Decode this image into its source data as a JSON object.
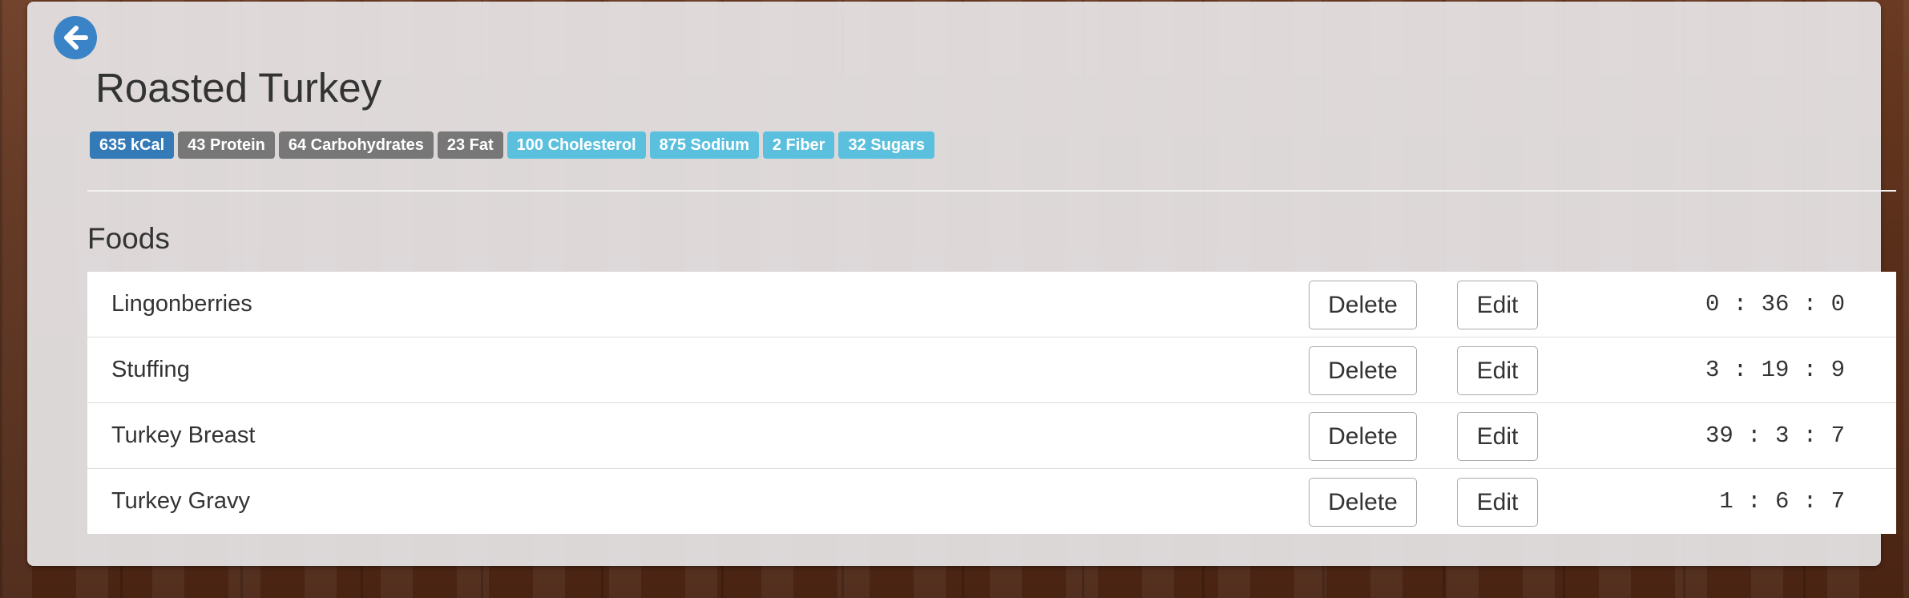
{
  "recipe": {
    "title": "Roasted Turkey",
    "badges": [
      {
        "text": "635 kCal",
        "style": "primary"
      },
      {
        "text": "43 Protein",
        "style": "default"
      },
      {
        "text": "64 Carbohydrates",
        "style": "default"
      },
      {
        "text": "23 Fat",
        "style": "default"
      },
      {
        "text": "100 Cholesterol",
        "style": "info"
      },
      {
        "text": "875 Sodium",
        "style": "info"
      },
      {
        "text": "2 Fiber",
        "style": "info"
      },
      {
        "text": "32 Sugars",
        "style": "info"
      }
    ]
  },
  "foods": {
    "heading": "Foods",
    "delete_label": "Delete",
    "edit_label": "Edit",
    "items": [
      {
        "name": "Lingonberries",
        "time": " 0 : 36 : 0"
      },
      {
        "name": "Stuffing",
        "time": " 3 : 19 : 9"
      },
      {
        "name": "Turkey Breast",
        "time": "39 : 3 : 7"
      },
      {
        "name": "Turkey Gravy",
        "time": " 1 : 6 : 7"
      }
    ]
  },
  "icons": {
    "back": "arrow-left-circle-icon"
  },
  "colors": {
    "primary": "#337ab7",
    "default": "#777777",
    "info": "#5bc0de",
    "back_button": "#3a83c6"
  }
}
